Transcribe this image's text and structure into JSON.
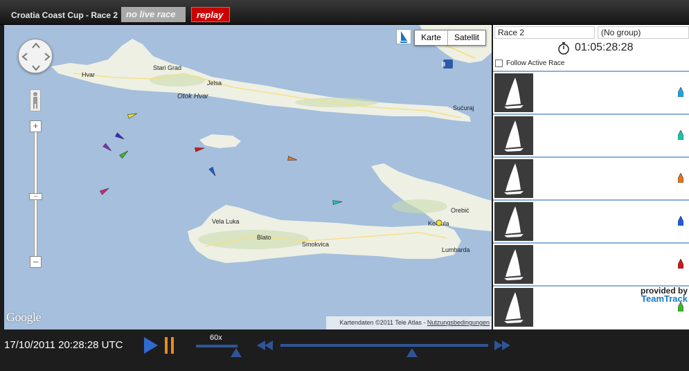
{
  "header": {
    "race_title": "Croatia Coast Cup - Race 2",
    "tab_live": "no live race",
    "tab_replay": "replay"
  },
  "map": {
    "type_map": "Karte",
    "type_satellite": "Satellit",
    "road_badge": "8",
    "places": [
      "Hvar",
      "Stari Grad",
      "Jelsa",
      "Otok Hvar",
      "Sućuraj",
      "Vela Luka",
      "Blato",
      "Smokvica",
      "Orebić",
      "Korčula",
      "Lumbarda"
    ],
    "google_logo": "Google",
    "attribution_text": "Kartendaten ©2011 Tele Atlas - ",
    "attribution_link": "Nutzungsbedingungen"
  },
  "panel": {
    "race_select": "Race 2",
    "group_select": "(No group)",
    "elapsed": "01:05:28:28",
    "follow_label": "Follow Active Race",
    "boats": [
      {
        "name": "",
        "color": "#1fa5e0"
      },
      {
        "name": "",
        "color": "#18c6a8"
      },
      {
        "name": "",
        "color": "#e8731c"
      },
      {
        "name": "",
        "color": "#1d5fd8"
      },
      {
        "name": "",
        "color": "#d01818"
      },
      {
        "name": "",
        "color": "#3cb828"
      }
    ],
    "provided_by": "provided by",
    "provided_brand": "TeamTrack"
  },
  "map_boats": [
    {
      "color": "#e6e61e"
    },
    {
      "color": "#3a28d0"
    },
    {
      "color": "#8a2ad0"
    },
    {
      "color": "#38c020"
    },
    {
      "color": "#d81818"
    },
    {
      "color": "#e8731c"
    },
    {
      "color": "#1d5fd8"
    },
    {
      "color": "#e0207a"
    },
    {
      "color": "#18c6a8"
    }
  ],
  "footer": {
    "datetime": "17/10/2011 20:28:28 UTC",
    "speed": "60x"
  }
}
